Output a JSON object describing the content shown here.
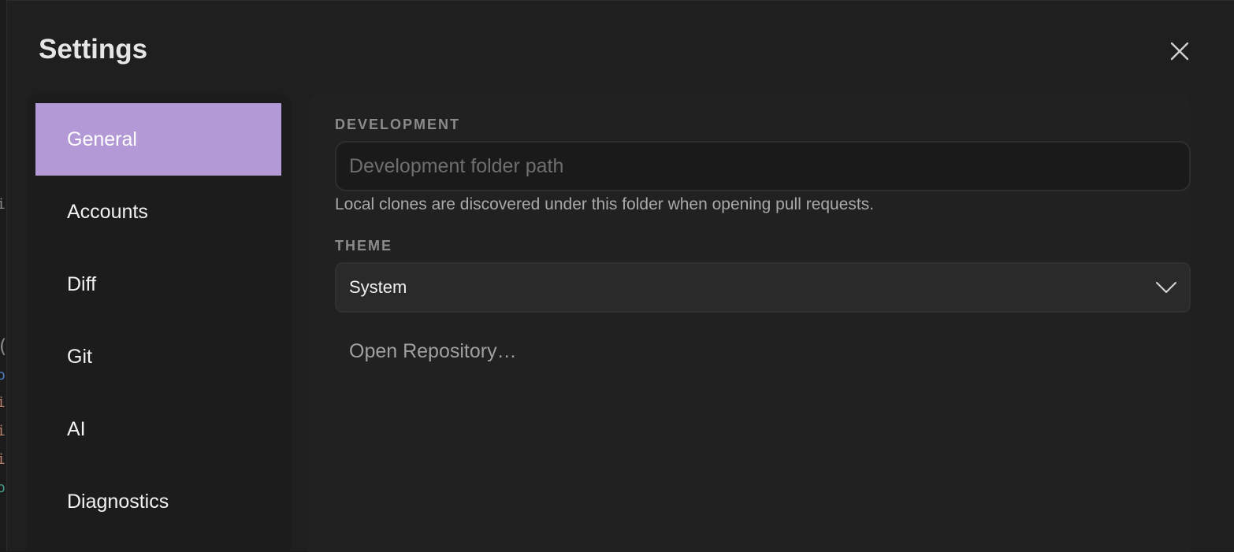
{
  "dialog": {
    "title": "Settings",
    "close_icon": "close-icon"
  },
  "sidebar": {
    "items": [
      {
        "label": "General",
        "active": true
      },
      {
        "label": "Accounts",
        "active": false
      },
      {
        "label": "Diff",
        "active": false
      },
      {
        "label": "Git",
        "active": false
      },
      {
        "label": "AI",
        "active": false
      },
      {
        "label": "Diagnostics",
        "active": false
      }
    ]
  },
  "general": {
    "development": {
      "label": "DEVELOPMENT",
      "value": "",
      "placeholder": "Development folder path",
      "helper": "Local clones are discovered under this folder when opening pull requests."
    },
    "theme": {
      "label": "THEME",
      "selected": "System",
      "icon": "chevron-down-icon"
    },
    "open_repository": "Open Repository…"
  },
  "colors": {
    "accent": "#b39ad6",
    "dialog_bg": "#1f1f1f",
    "text": "#f2f2f2",
    "muted": "#8b8b8b"
  }
}
